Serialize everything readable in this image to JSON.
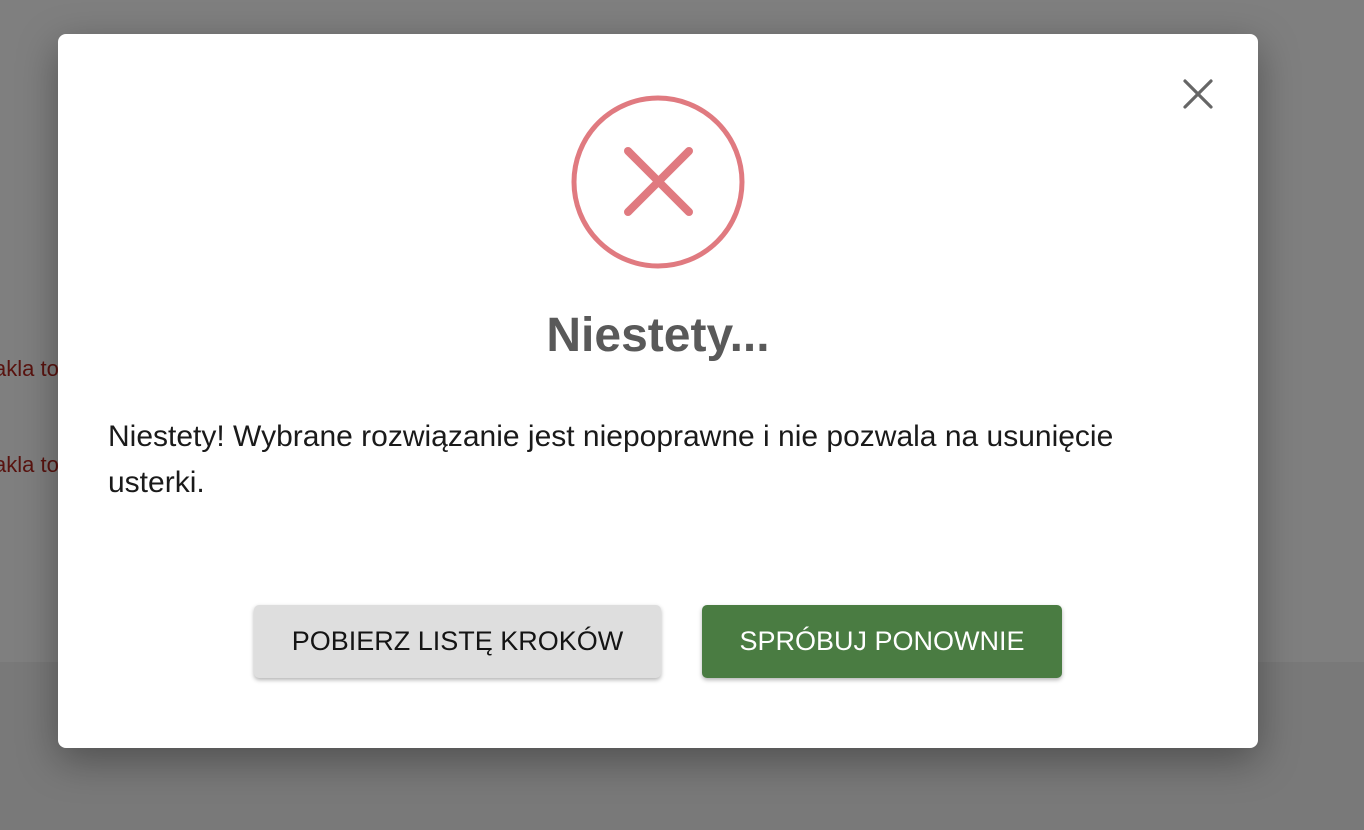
{
  "background": {
    "text_fragments": [
      "akla to",
      "akla to"
    ]
  },
  "dialog": {
    "close_icon": "close-icon",
    "status_icon": "error-circle-x-icon",
    "title": "Niestety...",
    "message": "Niestety! Wybrane rozwiązanie jest niepoprawne i nie pozwala na usunięcie usterki.",
    "buttons": {
      "download_steps_label": "POBIERZ LISTĘ KROKÓW",
      "retry_label": "SPRÓBUJ PONOWNIE"
    }
  },
  "colors": {
    "error_icon": "#e07a80",
    "primary_button": "#4a7c42",
    "secondary_button": "#dedede",
    "title": "#595959",
    "background_text": "#b3261e"
  }
}
